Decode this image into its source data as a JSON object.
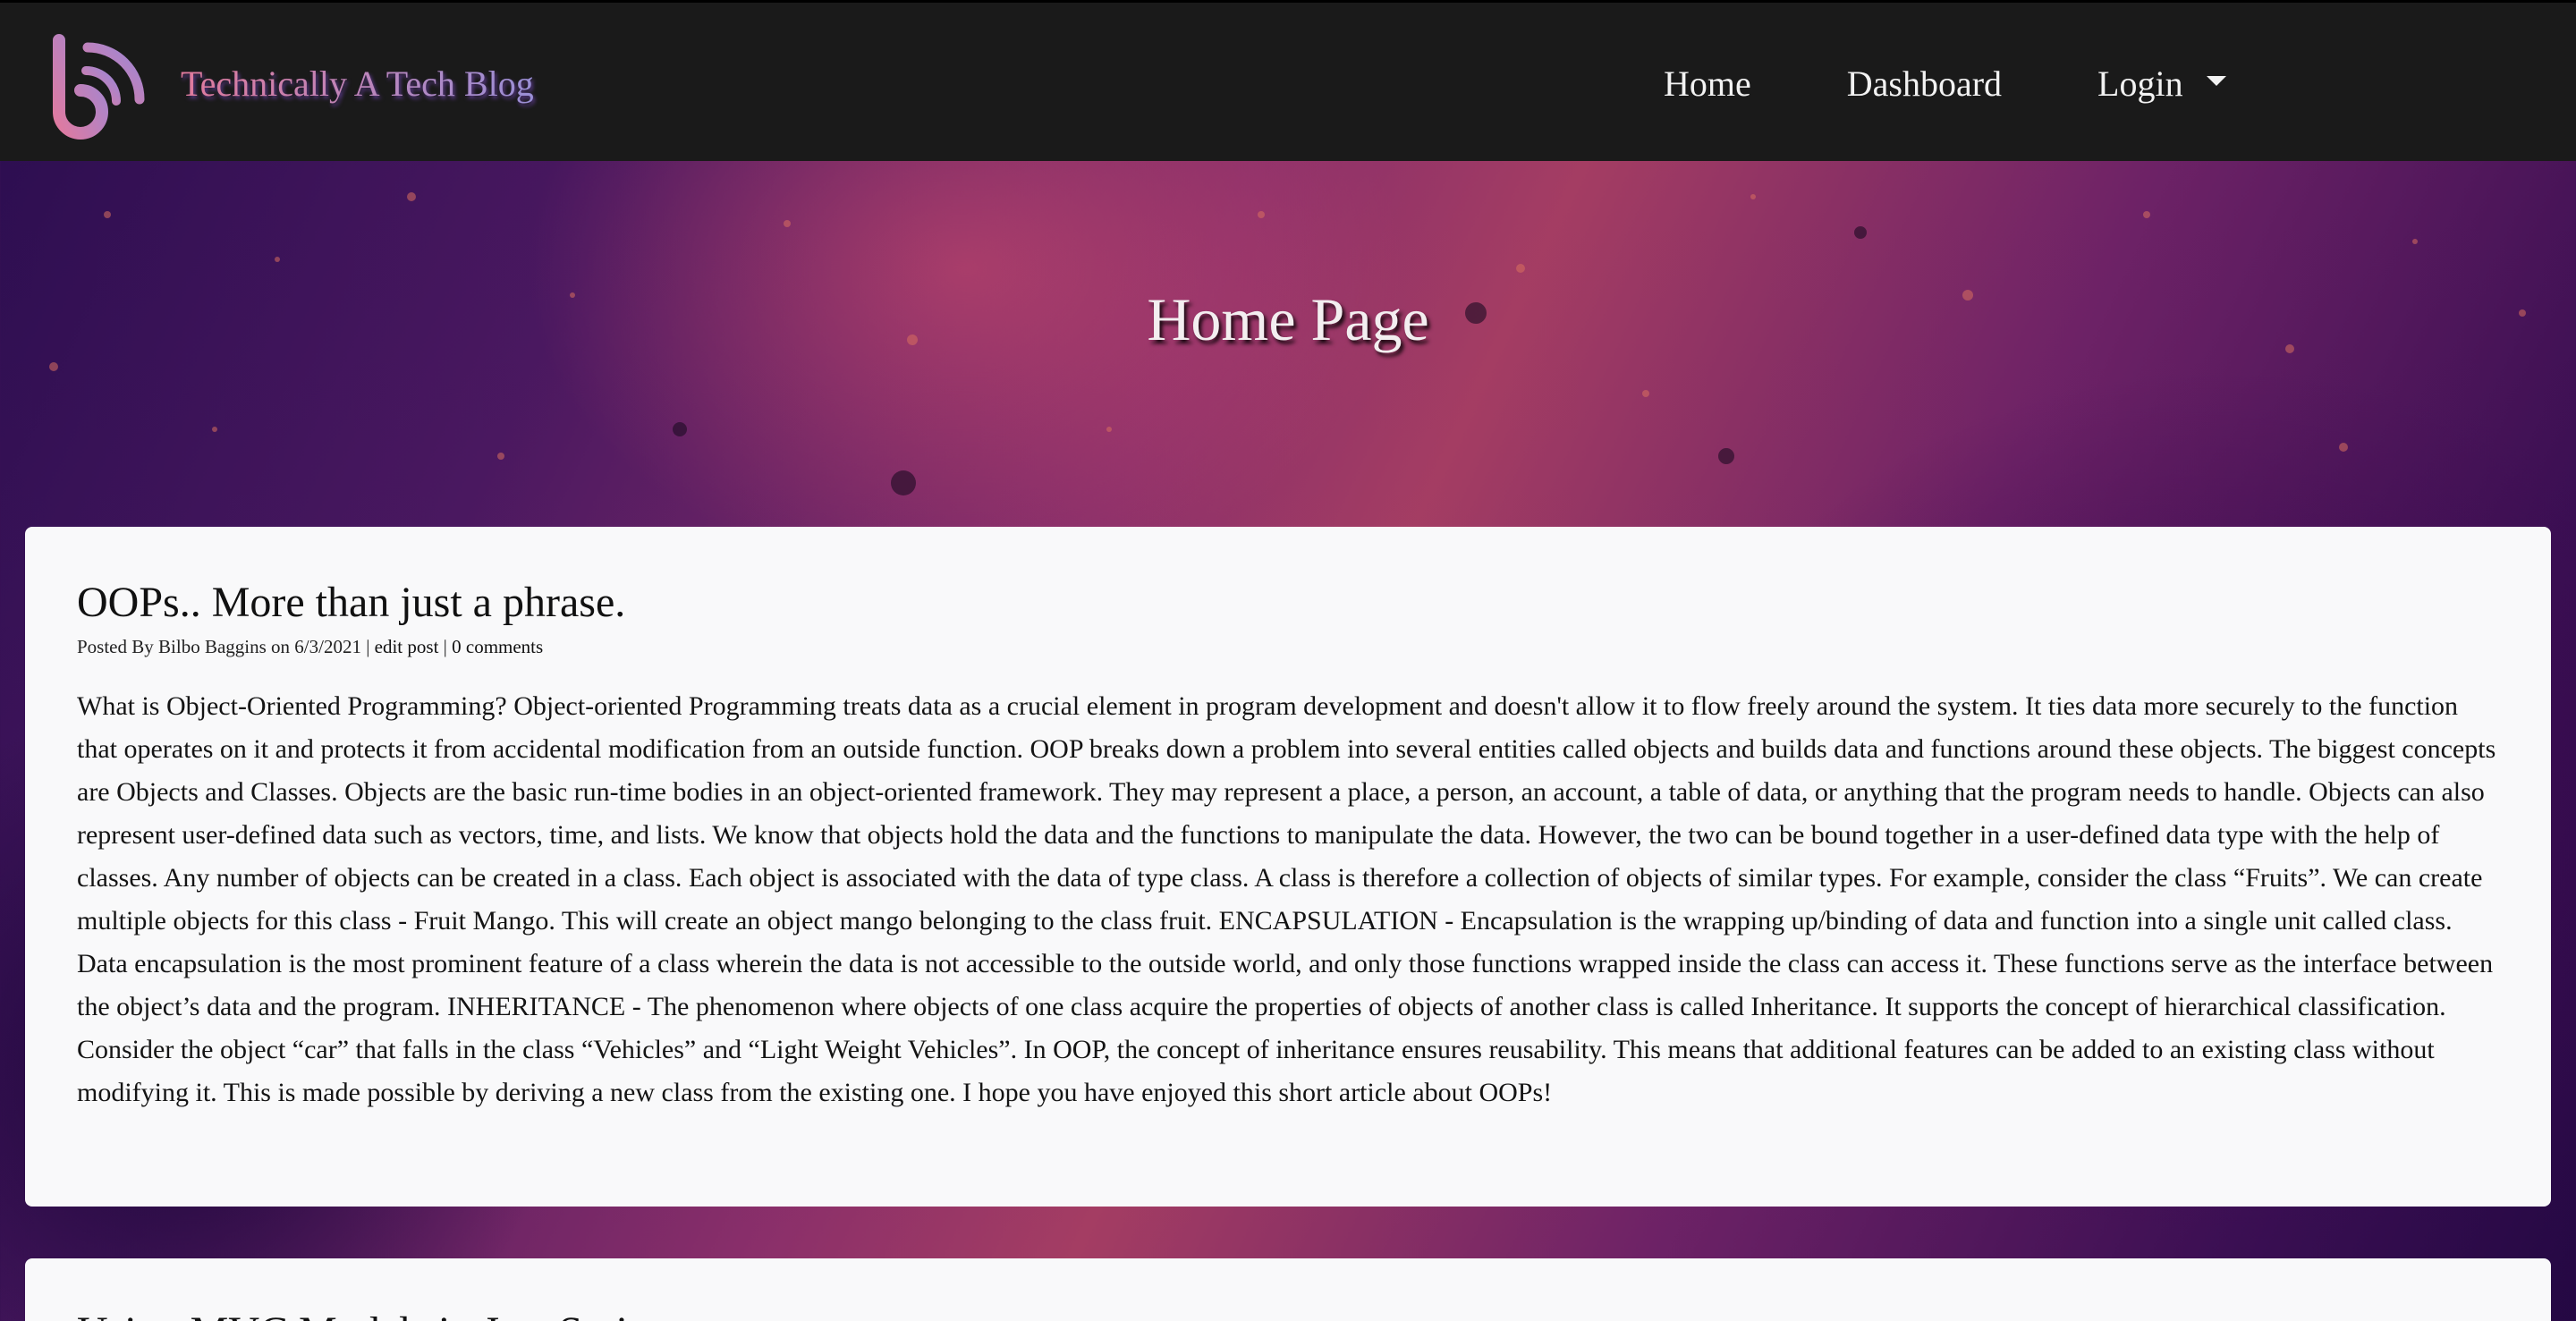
{
  "navbar": {
    "brand_name": "Technically A Tech Blog",
    "logo_icon": "blog-b-logo-icon",
    "links": [
      {
        "label": "Home"
      },
      {
        "label": "Dashboard"
      },
      {
        "label": "Login",
        "icon": "caret-down-icon"
      }
    ]
  },
  "hero": {
    "title": "Home Page"
  },
  "posts": [
    {
      "title": "OOPs.. More than just a phrase.",
      "meta": {
        "prefix": "Posted By Bilbo Baggins on 6/3/2021 | ",
        "edit_label": "edit post",
        "separator": " | ",
        "comments_label": "0 comments"
      },
      "body": "What is Object-Oriented Programming? Object-oriented Programming treats data as a crucial element in program development and doesn't allow it to flow freely around the system. It ties data more securely to the function that operates on it and protects it from accidental modification from an outside function. OOP breaks down a problem into several entities called objects and builds data and functions around these objects. The biggest concepts are Objects and Classes. Objects are the basic run-time bodies in an object-oriented framework. They may represent a place, a person, an account, a table of data, or anything that the program needs to handle. Objects can also represent user-defined data such as vectors, time, and lists. We know that objects hold the data and the functions to manipulate the data. However, the two can be bound together in a user-defined data type with the help of classes. Any number of objects can be created in a class. Each object is associated with the data of type class. A class is therefore a collection of objects of similar types. For example, consider the class “Fruits”. We can create multiple objects for this class - Fruit Mango. This will create an object mango belonging to the class fruit. ENCAPSULATION - Encapsulation is the wrapping up/binding of data and function into a single unit called class. Data encapsulation is the most prominent feature of a class wherein the data is not accessible to the outside world, and only those functions wrapped inside the class can access it. These functions serve as the interface between the object’s data and the program. INHERITANCE - The phenomenon where objects of one class acquire the properties of objects of another class is called Inheritance. It supports the concept of hierarchical classification. Consider the object “car” that falls in the class “Vehicles” and “Light Weight Vehicles”. In OOP, the concept of inheritance ensures reusability. This means that additional features can be added to an existing class without modifying it. This is made possible by deriving a new class from the existing one. I hope you have enjoyed this short article about OOPs!"
    },
    {
      "title": "Using MVC Models in JavaScript"
    }
  ]
}
